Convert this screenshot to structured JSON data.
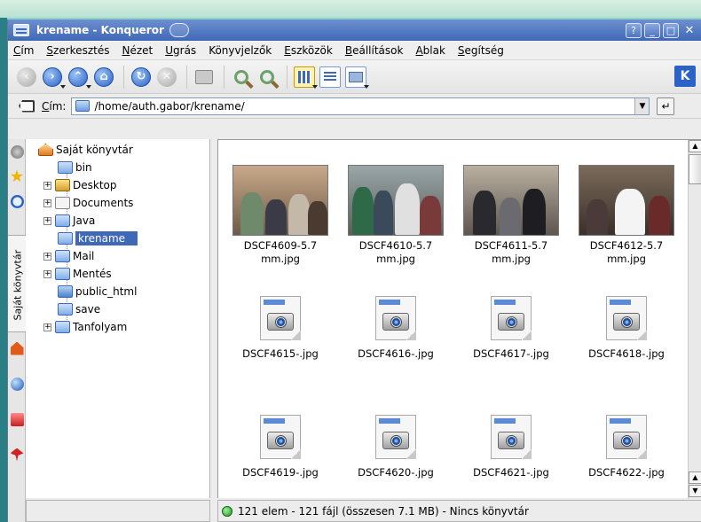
{
  "window": {
    "title": "krename - Konqueror",
    "buttons": {
      "help": "?",
      "minimize": "_",
      "maximize": "□",
      "close": "✕"
    }
  },
  "menu": {
    "items": [
      {
        "pre": "",
        "key": "C",
        "post": "ím"
      },
      {
        "pre": "",
        "key": "S",
        "post": "zerkesztés"
      },
      {
        "pre": "",
        "key": "N",
        "post": "ézet"
      },
      {
        "pre": "",
        "key": "U",
        "post": "grás"
      },
      {
        "pre": "Könyvjelzők",
        "key": "",
        "post": ""
      },
      {
        "pre": "",
        "key": "E",
        "post": "szközök"
      },
      {
        "pre": "",
        "key": "B",
        "post": "eállítások"
      },
      {
        "pre": "",
        "key": "A",
        "post": "blak"
      },
      {
        "pre": "",
        "key": "S",
        "post": "egítség"
      }
    ]
  },
  "toolbar": {
    "icons": [
      "back-icon",
      "forward-icon",
      "up-icon",
      "home-icon",
      "reload-icon",
      "stop-icon",
      "print-icon",
      "zoom-in-icon",
      "zoom-out-icon",
      "icon-view-icon",
      "detailed-list-view-icon",
      "image-preview-icon"
    ],
    "kde_logo": "K"
  },
  "location": {
    "label_key": "C",
    "label_rest": "ím:",
    "path": "/home/auth.gabor/krename/"
  },
  "sidebar": {
    "vertical_tab_label": "Saját könyvtár",
    "tree": [
      {
        "label": "Saját könyvtár",
        "icon": "home",
        "expandable": false
      },
      {
        "label": "bin",
        "icon": "folder",
        "expandable": false
      },
      {
        "label": "Desktop",
        "icon": "desktop",
        "expandable": true
      },
      {
        "label": "Documents",
        "icon": "documents",
        "expandable": true
      },
      {
        "label": "Java",
        "icon": "folder",
        "expandable": true
      },
      {
        "label": "krename",
        "icon": "folder",
        "expandable": false,
        "selected": true
      },
      {
        "label": "Mail",
        "icon": "folder",
        "expandable": true
      },
      {
        "label": "Mentés",
        "icon": "folder",
        "expandable": true
      },
      {
        "label": "public_html",
        "icon": "web-folder",
        "expandable": false
      },
      {
        "label": "save",
        "icon": "folder",
        "expandable": false
      },
      {
        "label": "Tanfolyam",
        "icon": "folder",
        "expandable": true
      }
    ]
  },
  "files": [
    {
      "line1": "DSCF4609-5.7",
      "line2": "mm.jpg",
      "type": "photo"
    },
    {
      "line1": "DSCF4610-5.7",
      "line2": "mm.jpg",
      "type": "photo"
    },
    {
      "line1": "DSCF4611-5.7",
      "line2": "mm.jpg",
      "type": "photo"
    },
    {
      "line1": "DSCF4612-5.7",
      "line2": "mm.jpg",
      "type": "photo"
    },
    {
      "line1": "DSCF4615-.jpg",
      "line2": "",
      "type": "image-icon"
    },
    {
      "line1": "DSCF4616-.jpg",
      "line2": "",
      "type": "image-icon"
    },
    {
      "line1": "DSCF4617-.jpg",
      "line2": "",
      "type": "image-icon"
    },
    {
      "line1": "DSCF4618-.jpg",
      "line2": "",
      "type": "image-icon"
    },
    {
      "line1": "DSCF4619-.jpg",
      "line2": "",
      "type": "image-icon"
    },
    {
      "line1": "DSCF4620-.jpg",
      "line2": "",
      "type": "image-icon"
    },
    {
      "line1": "DSCF4621-.jpg",
      "line2": "",
      "type": "image-icon"
    },
    {
      "line1": "DSCF4622-.jpg",
      "line2": "",
      "type": "image-icon"
    }
  ],
  "status": {
    "text": "121 elem - 121 fájl (összesen 7.1 MB) - Nincs könyvtár"
  }
}
